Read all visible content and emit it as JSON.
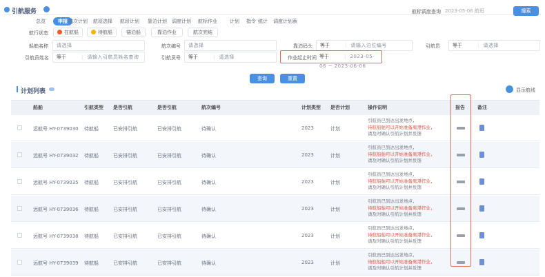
{
  "header": {
    "title": "引航服务",
    "right_label": "航标调度查询",
    "right_value": "2023-05-06 航班",
    "right_button": "搜索"
  },
  "tabs": [
    {
      "label": "总览",
      "active": false
    },
    {
      "label": "申报",
      "active": true
    },
    {
      "label": "航次计划",
      "active": false
    },
    {
      "label": "航班选择",
      "active": false
    },
    {
      "label": "航段计划",
      "active": false
    },
    {
      "label": "靠泊计划",
      "active": false
    },
    {
      "label": "调度计划",
      "active": false
    },
    {
      "label": "航标作业",
      "active": false
    },
    {
      "label": "计划",
      "active": false
    },
    {
      "label": "指令",
      "active": false
    },
    {
      "label": "统计",
      "active": false
    },
    {
      "label": "调度计划表",
      "active": false
    }
  ],
  "status_row": {
    "label": "航行状态",
    "pills": [
      {
        "label": "在航船",
        "color": "#f05a28"
      },
      {
        "label": "待航船",
        "color": "#f5b400"
      },
      {
        "label": "锚泊船",
        "color": ""
      },
      {
        "label": "靠泊作业",
        "color": ""
      },
      {
        "label": "航次完结",
        "color": ""
      }
    ]
  },
  "filters": {
    "row1": [
      {
        "label": "船舶名称",
        "placeholder": "请选择"
      },
      {
        "label": "航次编号",
        "placeholder": "请选择"
      },
      {
        "label": "靠泊码头",
        "op": "等于",
        "value": "请输入泊位编号"
      },
      {
        "label": "引航员",
        "op": "等于",
        "value": "请选择"
      }
    ],
    "row2": [
      {
        "label": "引航员姓名",
        "op": "等于",
        "value": "请输入引航员姓名查询"
      },
      {
        "label": "引航员号",
        "op": "等于",
        "value": "请选择"
      },
      {
        "label": "作业起止时间",
        "op": "等于",
        "value": "2023-05-06 ~ 2023-06-06"
      }
    ]
  },
  "actions": {
    "search": "查询",
    "reset": "重置"
  },
  "list": {
    "title": "计划列表",
    "toggle_label": "显示航线"
  },
  "table": {
    "columns": [
      "船舶",
      "引航类型",
      "是否引航",
      "是否引航",
      "航次编号",
      "计划类型",
      "是否计划",
      "操作说明",
      "报告",
      "备注"
    ],
    "rows": [
      {
        "ship": "远航号 HY-0739030",
        "type": "待航船",
        "c3": "已安排引航",
        "c4": "已安排引航",
        "c5": "待确认",
        "plan": "2023",
        "flag": "计划",
        "ops": [
          "引航员已到达出发地点，",
          "待航船舶可以开始准备离港作业，",
          "请及时确认引航计划并反馈"
        ]
      },
      {
        "ship": "远航号 HY-0739032",
        "type": "待航船",
        "c3": "已安排引航",
        "c4": "已安排引航",
        "c5": "待确认",
        "plan": "2023",
        "flag": "计划",
        "ops": [
          "引航员已到达出发地点，",
          "待航船舶可以开始准备离港作业，",
          "请及时确认引航计划并反馈"
        ]
      },
      {
        "ship": "远航号 HY-0739035",
        "type": "待航船",
        "c3": "已安排引航",
        "c4": "已安排引航",
        "c5": "待确认",
        "plan": "2023",
        "flag": "计划",
        "ops": [
          "引航员已到达出发地点，",
          "待航船舶可以开始准备离港作业，",
          "请及时确认引航计划并反馈"
        ]
      },
      {
        "ship": "远航号 HY-0739036",
        "type": "待航船",
        "c3": "已安排引航",
        "c4": "已安排引航",
        "c5": "待确认",
        "plan": "2023",
        "flag": "计划",
        "ops": [
          "引航员已到达出发地点，",
          "待航船舶可以开始准备离港作业，",
          "请及时确认引航计划并反馈"
        ]
      },
      {
        "ship": "远航号 HY-0739038",
        "type": "待航船",
        "c3": "已安排引航",
        "c4": "已安排引航",
        "c5": "待确认",
        "plan": "2023",
        "flag": "计划",
        "ops": [
          "引航员已到达出发地点，",
          "待航船舶可以开始准备离港作业，",
          "请及时确认引航计划并反馈"
        ]
      },
      {
        "ship": "远航号 HY-0739039",
        "type": "待航船",
        "c3": "已安排引航",
        "c4": "已安排引航",
        "c5": "待确认",
        "plan": "2023",
        "flag": "计划",
        "ops": [
          "引航员已到达出发地点，",
          "待航船舶可以开始准备离港作业，",
          "请及时确认引航计划并反馈"
        ]
      }
    ]
  }
}
